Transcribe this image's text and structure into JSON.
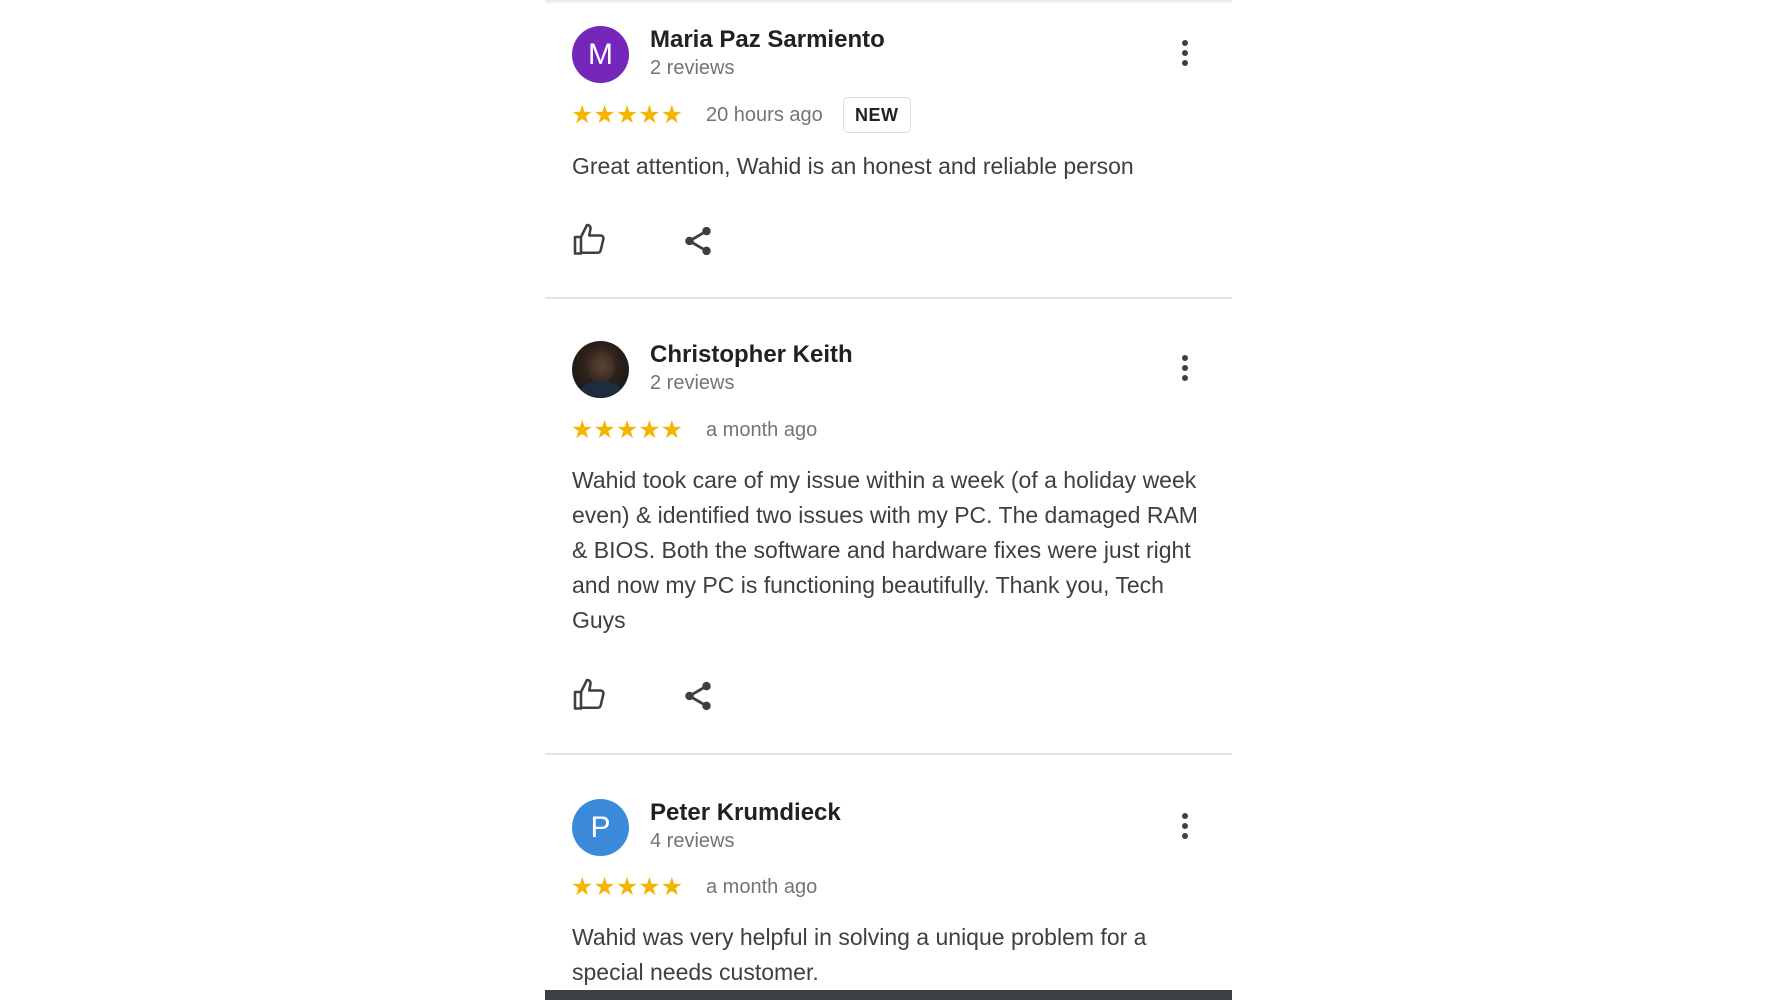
{
  "colors": {
    "star": "#f4b400",
    "avatar_m": "#7627bb",
    "avatar_p": "#3b8ad9"
  },
  "reviews": [
    {
      "avatar_letter": "M",
      "name": "Maria Paz Sarmiento",
      "review_count": "2 reviews",
      "rating": 5,
      "stars": "★★★★★",
      "time": "20 hours ago",
      "badge": "NEW",
      "text": "Great attention, Wahid is an honest and reliable person"
    },
    {
      "avatar_letter": "",
      "name": "Christopher Keith",
      "review_count": "2 reviews",
      "rating": 5,
      "stars": "★★★★★",
      "time": "a month ago",
      "text": "Wahid took care of my issue within a week (of a holiday week even) & identified two issues with my PC. The damaged RAM & BIOS. Both the software and hardware fixes were just right and now my PC is functioning beautifully. Thank you, Tech Guys"
    },
    {
      "avatar_letter": "P",
      "name": "Peter Krumdieck",
      "review_count": "4 reviews",
      "rating": 5,
      "stars": "★★★★★",
      "time": "a month ago",
      "text": "Wahid was very helpful in solving a unique problem for a special needs customer."
    }
  ]
}
